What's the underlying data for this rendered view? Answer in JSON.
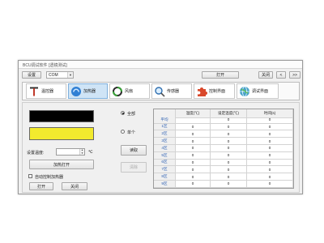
{
  "window": {
    "title": "BCU调试软件 [透镜测试]"
  },
  "toolbar": {
    "settings_label": "设置",
    "port_value": "COM",
    "open_label": "打开",
    "close_label": "关闭",
    "prev_label": "<",
    "next_label": ">>"
  },
  "tabs": [
    {
      "label": "温控器",
      "icon": "thermometer-icon",
      "selected": false
    },
    {
      "label": "加热器",
      "icon": "heater-icon",
      "selected": true
    },
    {
      "label": "风扇",
      "icon": "fan-icon",
      "selected": false
    },
    {
      "label": "传感器",
      "icon": "magnifier-icon",
      "selected": false
    },
    {
      "label": "控制界面",
      "icon": "puzzle-icon",
      "selected": false
    },
    {
      "label": "调试界面",
      "icon": "globe-icon",
      "selected": false
    }
  ],
  "heater": {
    "indicator_colors": [
      "#000000",
      "#f2ea2e"
    ],
    "set_temp_label": "设置温度:",
    "set_temp_value": "",
    "unit": "℃",
    "toggle_label": "加热打开",
    "auto_label": "自动控制加热器",
    "auto_checked": false,
    "open_label": "打开",
    "close_label": "关闭"
  },
  "read": {
    "all_label": "全部",
    "single_label": "单个",
    "selected": "all",
    "read_label": "读取",
    "clear_label": "清除"
  },
  "table": {
    "columns": [
      "",
      "温度(℃)",
      "设定温度(℃)",
      "时间(s)"
    ],
    "rows": [
      {
        "label": "平均",
        "values": [
          "",
          "0",
          "0"
        ]
      },
      {
        "label": "1区",
        "values": [
          "0",
          "0",
          "0"
        ]
      },
      {
        "label": "2区",
        "values": [
          "0",
          "0",
          "0"
        ]
      },
      {
        "label": "3区",
        "values": [
          "0",
          "0",
          "0"
        ]
      },
      {
        "label": "4区",
        "values": [
          "0",
          "0",
          "0"
        ]
      },
      {
        "label": "5区",
        "values": [
          "0",
          "0",
          "0"
        ]
      },
      {
        "label": "6区",
        "values": [
          "0",
          "0",
          "0"
        ]
      },
      {
        "label": "7区",
        "values": [
          "0",
          "0",
          "0"
        ]
      },
      {
        "label": "8区",
        "values": [
          "0",
          "0",
          "0"
        ]
      },
      {
        "label": "9区",
        "values": [
          "0",
          "0",
          "0"
        ]
      }
    ]
  }
}
